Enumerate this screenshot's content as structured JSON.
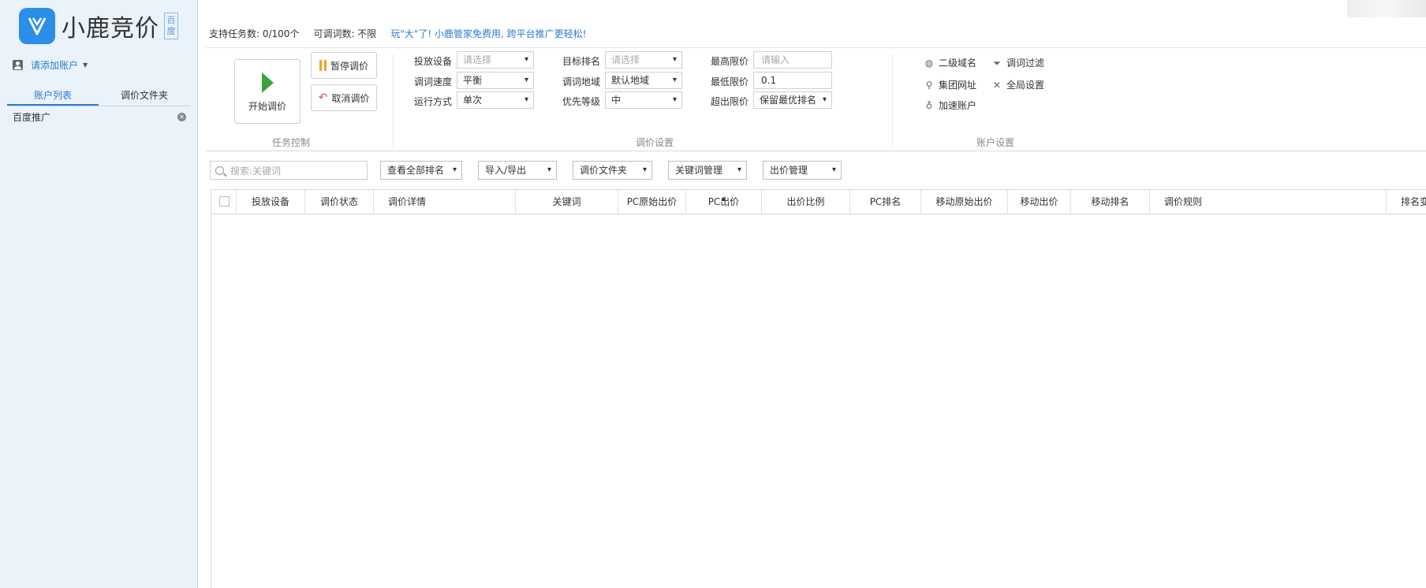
{
  "sidebar": {
    "logo_text": "小鹿竞价",
    "logo_badge": "百度",
    "add_account": "请添加账户",
    "tabs": [
      {
        "label": "账户列表"
      },
      {
        "label": "调价文件夹"
      }
    ],
    "accounts": [
      {
        "label": "百度推广"
      }
    ]
  },
  "topbar": {
    "task_count": "支持任务数: 0/100个",
    "adjust_count": "可调词数: 不限",
    "promo": "玩\"大\"了! 小鹿管家免费用, 跨平台推广更轻松!"
  },
  "task_control": {
    "start_label": "开始调价",
    "pause_label": "暂停调价",
    "cancel_label": "取消调价",
    "group_label": "任务控制"
  },
  "bid_settings": {
    "group_label": "调价设置",
    "device_label": "投放设备",
    "device_value": "请选择",
    "speed_label": "调词速度",
    "speed_value": "平衡",
    "run_label": "运行方式",
    "run_value": "单次",
    "target_label": "目标排名",
    "target_value": "请选择",
    "region_label": "调词地域",
    "region_value": "默认地域",
    "priority_label": "优先等级",
    "priority_value": "中",
    "max_label": "最高限价",
    "max_placeholder": "请输入",
    "min_label": "最低限价",
    "min_value": "0.1",
    "over_label": "超出限价",
    "over_value": "保留最优排名"
  },
  "account_settings": {
    "group_label": "账户设置",
    "subdomain": "二级域名",
    "filter": "调词过滤",
    "group_url": "集团网址",
    "global": "全局设置",
    "accelerate": "加速账户"
  },
  "filterbar": {
    "search_placeholder": "搜索:关键词",
    "view_rank": "查看全部排名",
    "import_export": "导入/导出",
    "folder": "调价文件夹",
    "keyword_mgmt": "关键词管理",
    "bid_mgmt": "出价管理"
  },
  "table": {
    "columns": [
      "投放设备",
      "调价状态",
      "调价详情",
      "关键词",
      "PC原始出价",
      "PC出价",
      "出价比例",
      "PC排名",
      "移动原始出价",
      "移动出价",
      "移动排名",
      "调价规则",
      "排名变"
    ]
  }
}
